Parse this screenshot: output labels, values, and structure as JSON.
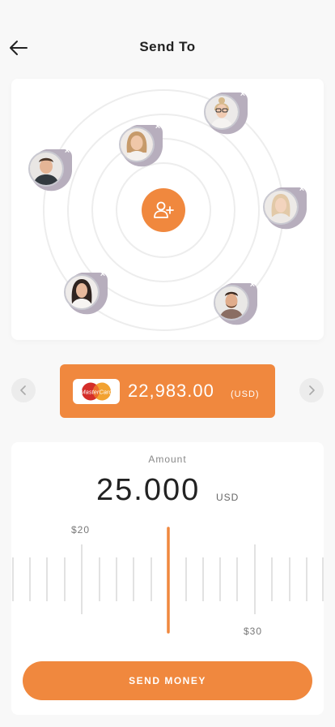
{
  "header": {
    "title": "Send To"
  },
  "contacts": [
    {
      "name_hint": "contact-man-dark-shirt"
    },
    {
      "name_hint": "contact-woman-blonde"
    },
    {
      "name_hint": "contact-woman-glasses"
    },
    {
      "name_hint": "contact-woman-light-hair"
    },
    {
      "name_hint": "contact-woman-dark-hair"
    },
    {
      "name_hint": "contact-man-beard"
    }
  ],
  "card": {
    "brand": "MasterCard",
    "balance": "22,983.00",
    "currency": "(USD)"
  },
  "amount": {
    "label": "Amount",
    "value": "25.000",
    "unit": "USD",
    "low_tick": "$20",
    "high_tick": "$30"
  },
  "actions": {
    "send": "SEND MONEY"
  },
  "colors": {
    "accent": "#f0883e",
    "background": "#f8f8f8",
    "card": "#ffffff"
  },
  "icons": [
    "back-arrow-icon",
    "add-user-icon",
    "close-icon",
    "chevron-left-icon",
    "chevron-right-icon",
    "mastercard-logo"
  ]
}
